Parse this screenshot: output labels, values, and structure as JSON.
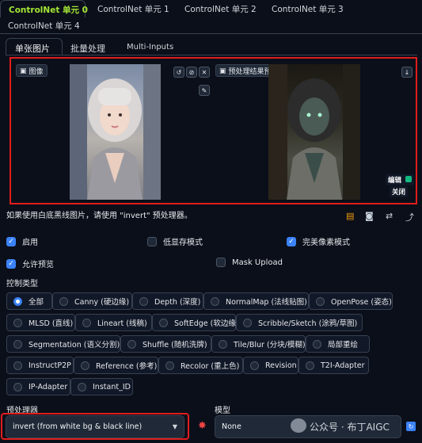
{
  "controlnet_tabs": [
    {
      "label": "ControlNet 单元 0",
      "active": true
    },
    {
      "label": "ControlNet 单元 1",
      "active": false
    },
    {
      "label": "ControlNet 单元 2",
      "active": false
    },
    {
      "label": "ControlNet 单元 3",
      "active": false
    },
    {
      "label": "ControlNet 单元 4",
      "active": false
    }
  ],
  "sub_tabs": [
    {
      "label": "单张图片",
      "active": true
    },
    {
      "label": "批量处理",
      "active": false
    },
    {
      "label": "Multi-Inputs",
      "active": false
    }
  ],
  "image_panel": {
    "input_label": "图像",
    "preview_label": "预处理结果预览",
    "edit_label": "编辑",
    "close_label": "关闭"
  },
  "hint_text": "如果使用白底黑线图片，请使用 \"invert\" 预处理器。",
  "options": {
    "enable": {
      "label": "启用",
      "checked": true
    },
    "low_vram": {
      "label": "低显存模式",
      "checked": false
    },
    "pixel_perfect": {
      "label": "完美像素模式",
      "checked": true
    },
    "allow_preview": {
      "label": "允许预览",
      "checked": true
    },
    "mask_upload": {
      "label": "Mask Upload",
      "checked": false
    }
  },
  "control_type": {
    "label": "控制类型",
    "selected": "全部",
    "items": [
      "全部",
      "Canny (硬边缘)",
      "Depth (深度)",
      "NormalMap (法线贴图)",
      "OpenPose (姿态)",
      "MLSD (直线)",
      "Lineart (线稿)",
      "SoftEdge (软边缘)",
      "Scribble/Sketch (涂鸦/草图)",
      "Segmentation (语义分割)",
      "Shuffle (随机洗牌)",
      "Tile/Blur (分块/模糊)",
      "局部重绘",
      "InstructP2P",
      "Reference (参考)",
      "Recolor (重上色)",
      "Revision",
      "T2I-Adapter",
      "IP-Adapter",
      "Instant_ID"
    ]
  },
  "preprocessor": {
    "label": "预处理器",
    "value": "invert (from white bg & black line)"
  },
  "model": {
    "label": "模型",
    "value": "None"
  },
  "watermark": "公众号 · 布丁AIGC",
  "colors": {
    "accent": "#a3e635",
    "highlight": "#e11d1d",
    "primary": "#3b82f6"
  }
}
